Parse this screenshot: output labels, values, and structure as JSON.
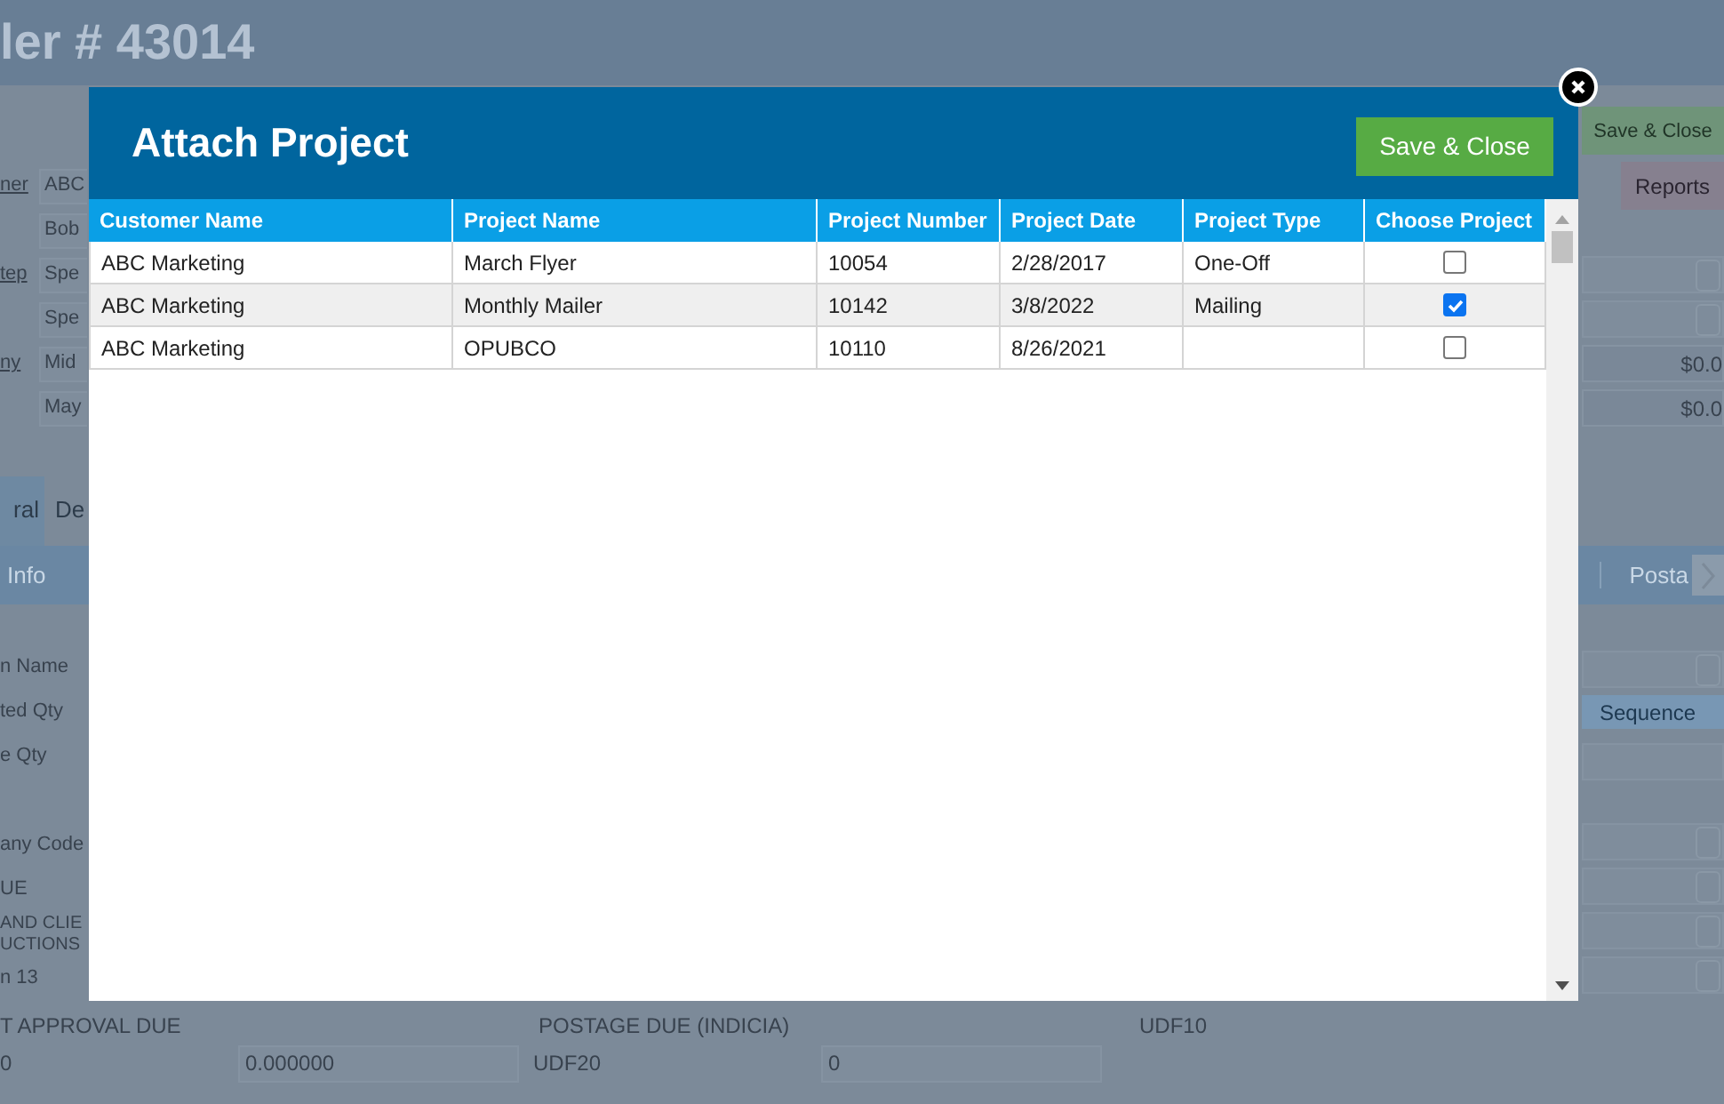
{
  "background": {
    "title": "ler # 43014",
    "header_fields": [
      {
        "label": "ner",
        "value": "ABC"
      },
      {
        "value": "Bob"
      },
      {
        "label": "tep",
        "value": "Spe"
      },
      {
        "value": "Spe"
      },
      {
        "label": "ny",
        "value": "Mid"
      },
      {
        "value": "May"
      }
    ],
    "buttons": [
      "Save & Close",
      "Reports"
    ],
    "amounts": [
      "$0.0",
      "$0.0"
    ],
    "tabs": [
      {
        "label": "ral",
        "selected": true
      },
      {
        "label": "De",
        "selected": false
      }
    ],
    "subtabs": [
      "Info",
      "Posta"
    ],
    "labels": [
      "n Name",
      "ted Qty",
      "e Qty",
      "any Code",
      "UE",
      "AND CLIE\nUCTIONS",
      "n 13"
    ],
    "sequence_button": "Sequence",
    "due_labels": [
      "T APPROVAL DUE",
      "POSTAGE DUE (INDICIA)",
      "UDF10"
    ],
    "last_row": {
      "label": "0",
      "field_1": "0.000000",
      "label_2": "UDF20",
      "field_2": "0"
    }
  },
  "modal": {
    "title": "Attach Project",
    "save_button": "Save & Close",
    "columns": [
      "Customer Name",
      "Project Name",
      "Project Number",
      "Project Date",
      "Project Type",
      "Choose Project"
    ],
    "rows": [
      {
        "cells": [
          "ABC Marketing",
          "March Flyer",
          "10054",
          "2/28/2017",
          "One-Off"
        ],
        "checked": false
      },
      {
        "cells": [
          "ABC Marketing",
          "Monthly Mailer",
          "10142",
          "3/8/2022",
          "Mailing"
        ],
        "checked": true
      },
      {
        "cells": [
          "ABC Marketing",
          "OPUBCO",
          "10110",
          "8/26/2021",
          ""
        ],
        "checked": false
      }
    ]
  }
}
